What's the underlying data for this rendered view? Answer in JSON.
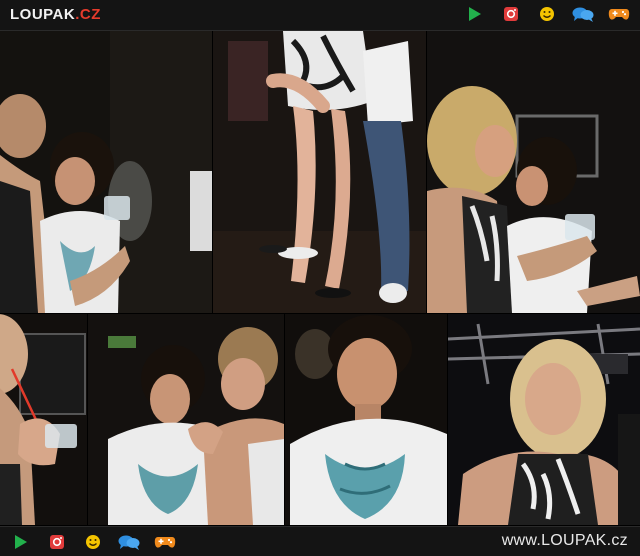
{
  "header": {
    "logo_main": "LOUPAK",
    "logo_dot": ".",
    "logo_tld": "CZ",
    "icons": [
      "play-icon",
      "instagram-icon",
      "smiley-icon",
      "chat-icon",
      "gamepad-icon"
    ]
  },
  "footer": {
    "site_url": "www.LOUPAK.cz",
    "icons": [
      "play-icon",
      "instagram-icon",
      "smiley-icon",
      "chat-icon",
      "gamepad-icon"
    ]
  },
  "colors": {
    "bar_bg": "#141414",
    "logo_red": "#e53b2c",
    "play_green": "#22b14c",
    "insta_red": "#e03b3b",
    "smiley_yellow": "#f4c400",
    "chat_blue": "#2f8fe0",
    "gamepad_orange": "#f08a1c"
  },
  "photos": [
    {
      "name": "photo-kiss-left"
    },
    {
      "name": "photo-legs-center"
    },
    {
      "name": "photo-kiss-right"
    },
    {
      "name": "photo-drink-left"
    },
    {
      "name": "photo-boys-middle"
    },
    {
      "name": "photo-man-closeup"
    },
    {
      "name": "photo-woman-right"
    }
  ]
}
